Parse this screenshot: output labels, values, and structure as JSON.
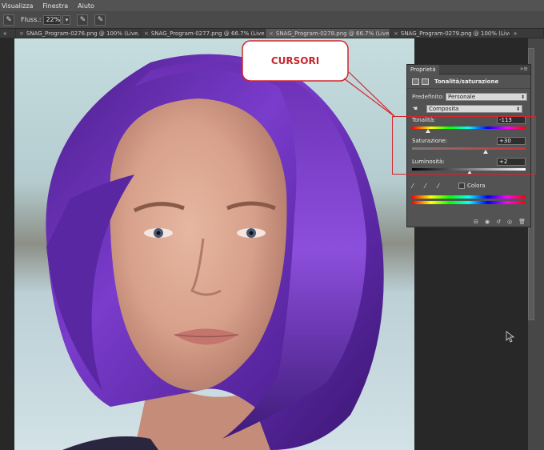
{
  "menubar": {
    "items": [
      "Visualizza",
      "Finestra",
      "Aiuto"
    ]
  },
  "options_bar": {
    "flow_label": "Fluss.:",
    "flow_value": "22%"
  },
  "tabs": [
    {
      "label": "SNAG_Program-0276.png @ 100% (Live..."
    },
    {
      "label": "SNAG_Program-0277.png @ 66.7% (Live..."
    },
    {
      "label": "SNAG_Program-0278.png @ 66.7% (Live..."
    },
    {
      "label": "SNAG_Program-0279.png @ 100% (Live..."
    }
  ],
  "annotation": {
    "callout_text": "CURSORI",
    "color": "#d2262e"
  },
  "panel": {
    "tab": "Proprietà",
    "title": "Tonalità/saturazione",
    "preset_label": "Predefinito:",
    "preset_value": "Personale",
    "channel_value": "Composita",
    "sliders": [
      {
        "label": "Tonalità:",
        "value": "-113",
        "fraction": 0.14
      },
      {
        "label": "Saturazione:",
        "value": "+30",
        "fraction": 0.65
      },
      {
        "label": "Luminosità:",
        "value": "+2",
        "fraction": 0.51
      }
    ],
    "colorize_label": "Colora"
  },
  "colors": {
    "panel_bg": "#535353",
    "canvas_bg": "#282828",
    "hair_purple": "#6a2fb3",
    "accent_red": "#d2262e"
  }
}
